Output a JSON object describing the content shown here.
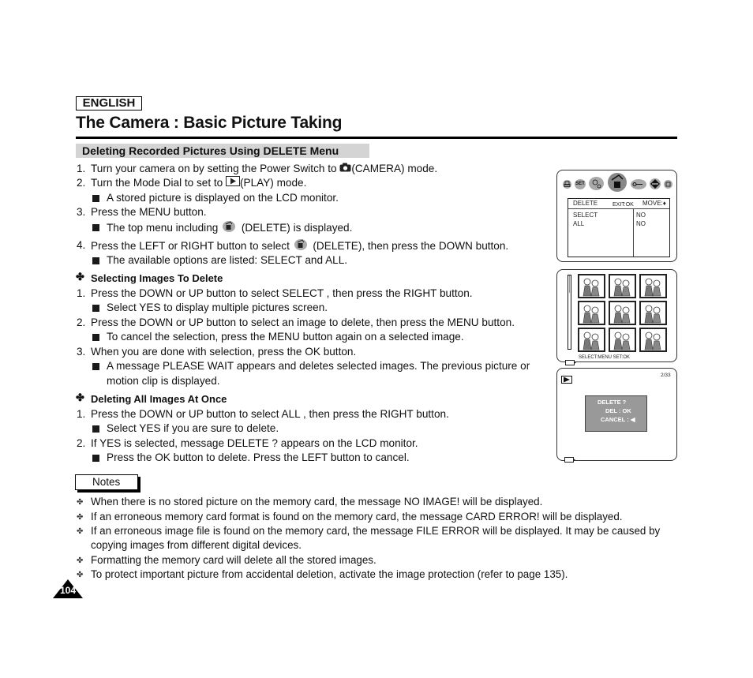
{
  "header": {
    "language": "ENGLISH",
    "title": "The Camera : Basic Picture Taking",
    "section": "Deleting Recorded Pictures Using DELETE Menu"
  },
  "steps": [
    {
      "num": "1.",
      "parts": [
        "Turn your camera on by setting the Power Switch to ",
        "(CAMERA) mode."
      ],
      "icon": "camera-icon"
    },
    {
      "num": "2.",
      "parts": [
        "Turn the Mode Dial to set to ",
        "(PLAY) mode."
      ],
      "icon": "play-mode-icon"
    },
    {
      "sub": "A stored picture is displayed on the LCD monitor."
    },
    {
      "num": "3.",
      "parts": [
        "Press the MENU button."
      ]
    },
    {
      "sub_parts": [
        "The top menu including ",
        "(DELETE) is displayed."
      ],
      "icon": "delete-menu-icon"
    },
    {
      "num": "4.",
      "parts": [
        "Press the LEFT or RIGHT button to select ",
        "(DELETE), then press the DOWN button."
      ],
      "icon": "delete-menu-icon"
    },
    {
      "sub": "The available options are listed: SELECT and ALL."
    }
  ],
  "selecting": {
    "heading": "Selecting Images To Delete",
    "items": [
      {
        "num": "1.",
        "text": "Press the DOWN or UP button to select  SELECT , then press the RIGHT button."
      },
      {
        "sub": "Select  YES  to display multiple pictures screen."
      },
      {
        "num": "2.",
        "text": "Press the DOWN or UP button to select an image to delete, then press the MENU button."
      },
      {
        "sub": "To cancel the selection, press the MENU button again on a selected image."
      },
      {
        "num": "3.",
        "text": "When you are done with selection, press the OK button."
      },
      {
        "sub": "A message  PLEASE WAIT  appears and deletes selected images. The previous picture or"
      },
      {
        "cont": "motion clip is displayed."
      }
    ]
  },
  "deleting_all": {
    "heading": "Deleting All Images At Once",
    "items": [
      {
        "num": "1.",
        "text": "Press the DOWN or UP button to select  ALL , then press the RIGHT button."
      },
      {
        "sub": "Select  YES  if you are sure to delete."
      },
      {
        "num": "2.",
        "text": "If  YES  is selected, message  DELETE ?  appears on the LCD monitor."
      },
      {
        "sub": "Press the OK button to delete. Press the LEFT button to cancel."
      }
    ]
  },
  "notes": {
    "label": "Notes",
    "items": [
      "When there is no stored picture on the memory card, the message  NO IMAGE!  will be displayed.",
      "If an erroneous memory card format is found on the memory card, the message  CARD ERROR!  will be displayed.",
      "If an erroneous image file is found on the memory card, the message  FILE ERROR  will be displayed. It may be caused by",
      "copying images from different digital devices.",
      "Formatting the memory card will delete all the stored images.",
      "To protect important picture from accidental deletion, activate the image protection (refer to page 135)."
    ]
  },
  "page_number": "104",
  "lcd_menu": {
    "icons": [
      "print-icon",
      "set-icon",
      "slideshow-icon",
      "delete-icon",
      "protect-key-icon",
      "direction-icon",
      "card-icon"
    ],
    "set_label": "SET",
    "header_title": "DELETE",
    "header_exit": "EXIT:OK",
    "header_move": "MOVE:♦",
    "options": [
      {
        "label": "SELECT",
        "value": "NO"
      },
      {
        "label": "ALL",
        "value": "NO"
      }
    ]
  },
  "lcd_grid": {
    "thumbnail_count": 9,
    "footer": "SELECT:MENU   SET:OK"
  },
  "lcd_confirm": {
    "counter": "2/33",
    "dialog_title": "DELETE ?",
    "dialog_ok": "DEL : OK",
    "dialog_cancel": "CANCEL : ◀"
  }
}
